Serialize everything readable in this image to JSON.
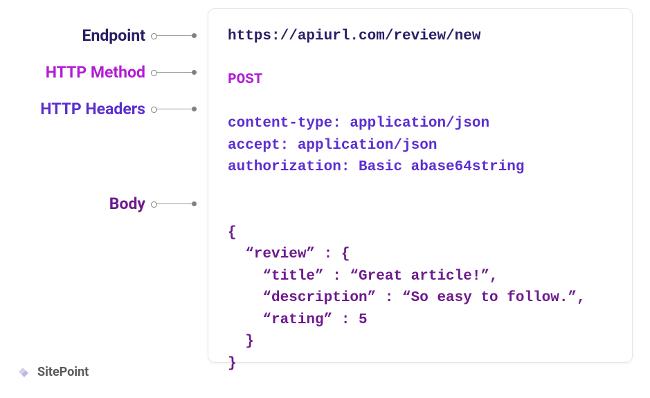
{
  "labels": {
    "endpoint": {
      "text": "Endpoint",
      "color": "#2b1d66"
    },
    "method": {
      "text": "HTTP Method",
      "color": "#b21cd6"
    },
    "headers": {
      "text": "HTTP Headers",
      "color": "#5b2ed1"
    },
    "body": {
      "text": "Body",
      "color": "#6d1a8e"
    }
  },
  "request": {
    "endpoint": {
      "text": "https://apiurl.com/review/new",
      "color": "#2b1d66"
    },
    "method": {
      "text": "POST",
      "color": "#b21cd6"
    },
    "headers_color": "#5b2ed1",
    "headers": [
      "content-type: application/json",
      "accept: application/json",
      "authorization: Basic abase64string"
    ],
    "body_color": "#6d1a8e",
    "body_lines": [
      "{",
      "  “review” : {",
      "    “title” : “Great article!”,",
      "    “description” : “So easy to follow.”,",
      "    “rating” : 5",
      "  }",
      "}"
    ]
  },
  "layout": {
    "label_offsets": {
      "endpoint": 8,
      "method": 62,
      "headers": 116,
      "body": 254
    }
  },
  "brand": {
    "name": "SitePoint"
  }
}
